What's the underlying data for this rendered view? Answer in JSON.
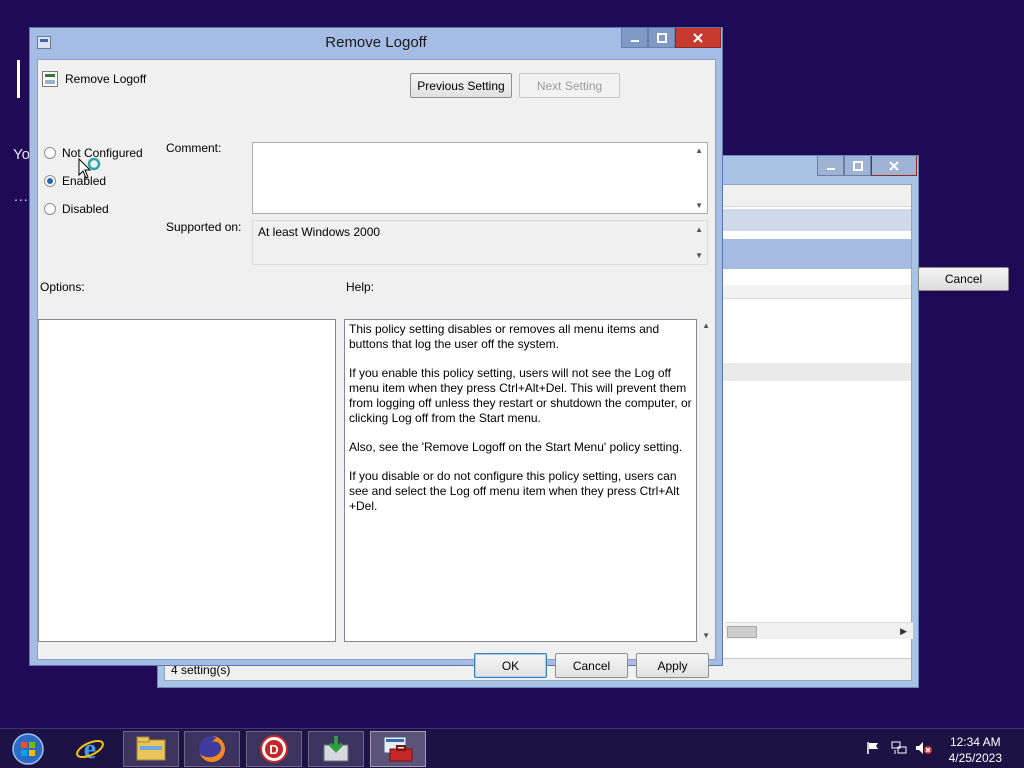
{
  "dialog": {
    "title": "Remove Logoff",
    "policy_name": "Remove Logoff",
    "previous_setting": "Previous Setting",
    "next_setting": "Next Setting",
    "radios": [
      {
        "label": "Not Configured",
        "checked": false
      },
      {
        "label": "Enabled",
        "checked": true
      },
      {
        "label": "Disabled",
        "checked": false
      }
    ],
    "comment_label": "Comment:",
    "comment_value": "",
    "supported_label": "Supported on:",
    "supported_value": "At least Windows 2000",
    "options_label": "Options:",
    "help_label": "Help:",
    "help_paragraphs": [
      "This policy setting disables or removes all menu items and buttons that log the user off the system.",
      "If you enable this policy setting, users will not see the Log off menu item when they press Ctrl+Alt+Del. This will prevent them from logging off unless they restart or shutdown the computer, or clicking Log off from the Start menu.",
      "Also, see the 'Remove Logoff on the Start Menu' policy setting.",
      "If you disable or do not configure this policy setting, users can see and select the Log off menu item when they press Ctrl+Alt +Del."
    ],
    "ok": "OK",
    "cancel": "Cancel",
    "apply": "Apply"
  },
  "background_window": {
    "status_text": "4 setting(s)",
    "cancel_button": "Cancel"
  },
  "desktop": {
    "partial_text": "Yo",
    "partial_dots": "..."
  },
  "taskbar": {
    "items": [
      {
        "icon": "start-orb-icon"
      },
      {
        "icon": "internet-explorer-icon"
      },
      {
        "icon": "file-explorer-icon"
      },
      {
        "icon": "firefox-icon"
      },
      {
        "icon": "app-d-icon"
      },
      {
        "icon": "download-installer-icon"
      },
      {
        "icon": "group-policy-toolbox-icon"
      }
    ],
    "time": "12:34 AM",
    "date": "4/25/2023"
  },
  "colors": {
    "desktop": "#1e0a57",
    "title_glass": "#a5bde5",
    "close_button": "#c73a2e"
  }
}
